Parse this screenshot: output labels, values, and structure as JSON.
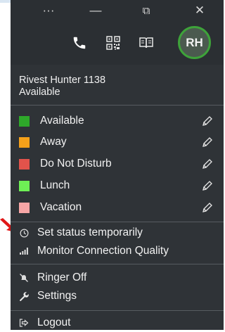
{
  "window": {
    "more_glyph": "···",
    "minimize_glyph": "—",
    "restore_glyph": "⧉",
    "close_glyph": "✕"
  },
  "header": {
    "avatar_initials": "RH",
    "avatar_ring_color": "#3ea33a"
  },
  "user": {
    "name": "Rivest Hunter  1138",
    "status": "Available"
  },
  "statuses": [
    {
      "label": "Available",
      "color": "#2ea82a"
    },
    {
      "label": "Away",
      "color": "#f5a11a"
    },
    {
      "label": "Do Not Disturb",
      "color": "#e2534b"
    },
    {
      "label": "Lunch",
      "color": "#6ef055"
    },
    {
      "label": "Vacation",
      "color": "#f7a6a6"
    }
  ],
  "menu": {
    "set_status_temporarily": "Set status temporarily",
    "monitor_connection_quality": "Monitor Connection Quality",
    "ringer_off": "Ringer Off",
    "settings": "Settings",
    "logout": "Logout"
  }
}
